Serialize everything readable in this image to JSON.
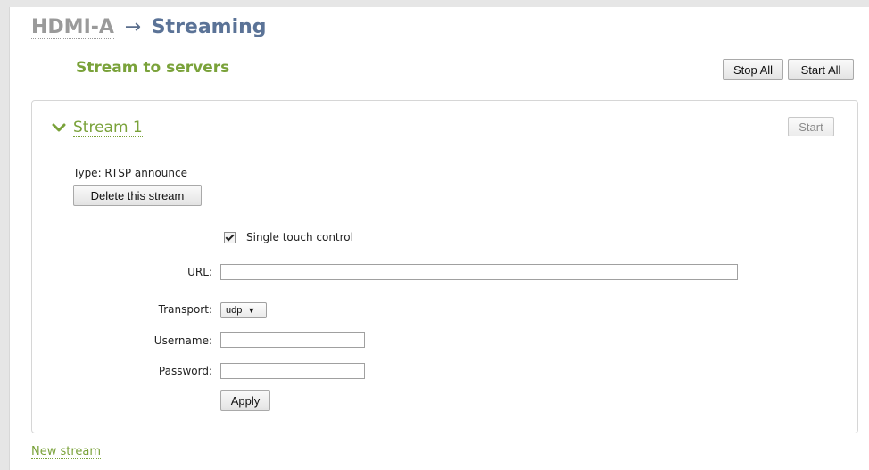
{
  "breadcrumb": {
    "parent": "HDMI-A",
    "arrow": "→",
    "current": "Streaming"
  },
  "section": {
    "title": "Stream to servers",
    "stop_all_label": "Stop All",
    "start_all_label": "Start All"
  },
  "stream": {
    "name": "Stream 1",
    "expanded": true,
    "start_label": "Start",
    "type_text": "Type: RTSP announce",
    "delete_label": "Delete this stream",
    "single_touch": {
      "label": "Single touch control",
      "checked": true
    },
    "fields": {
      "url_label": "URL:",
      "url_value": "",
      "transport_label": "Transport:",
      "transport_value": "udp",
      "username_label": "Username:",
      "username_value": "",
      "password_label": "Password:",
      "password_value": ""
    },
    "apply_label": "Apply"
  },
  "footer": {
    "new_stream_label": "New stream"
  },
  "colors": {
    "accent_green": "#7aa23a",
    "breadcrumb_blue": "#5b7397",
    "breadcrumb_gray": "#9a9a9a"
  },
  "icons": {
    "stream_toggle": "chevron-down-icon",
    "select_caret": "caret-down-icon",
    "checkbox_mark": "checkmark-icon"
  }
}
